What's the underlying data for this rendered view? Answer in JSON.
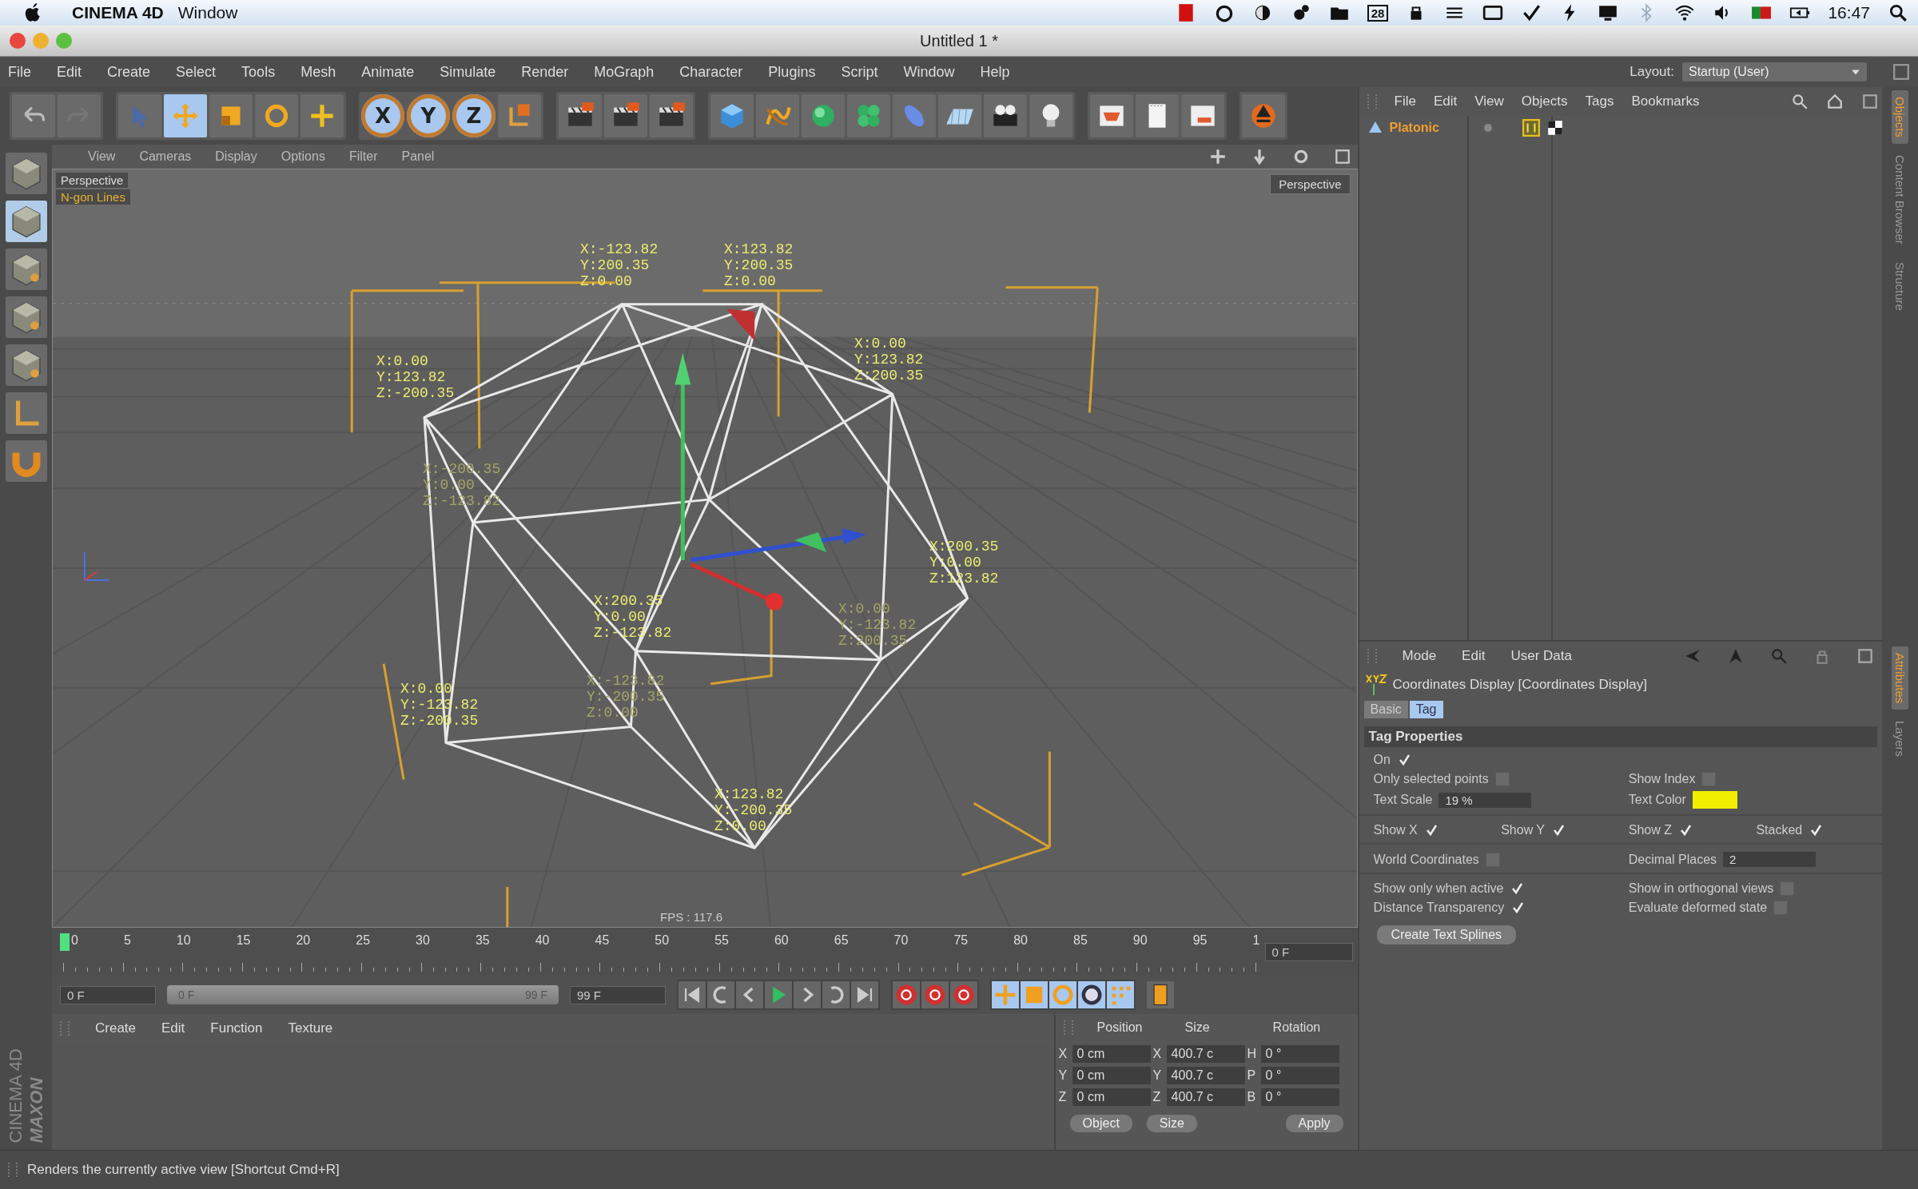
{
  "mac_menubar": {
    "app": "CINEMA 4D",
    "menus": [
      "Window"
    ],
    "calendar_day": "28",
    "time": "16:47"
  },
  "window": {
    "title": "Untitled 1 *"
  },
  "menu_bar": {
    "items": [
      "File",
      "Edit",
      "Create",
      "Select",
      "Tools",
      "Mesh",
      "Animate",
      "Simulate",
      "Render",
      "MoGraph",
      "Character",
      "Plugins",
      "Script",
      "Window",
      "Help"
    ],
    "layout_label": "Layout:",
    "layout_value": "Startup (User)"
  },
  "toolbar": {
    "tools": [
      {
        "selected": false
      },
      {
        "selected": true
      },
      {
        "selected": false
      },
      {
        "selected": false
      },
      {
        "selected": false
      }
    ],
    "axis_locks": [
      {
        "label": "X",
        "selected": true
      },
      {
        "label": "Y",
        "selected": true
      },
      {
        "label": "Z",
        "selected": true
      }
    ]
  },
  "viewport": {
    "menu": [
      "View",
      "Cameras",
      "Display",
      "Options",
      "Filter",
      "Panel"
    ],
    "camera_label": "Perspective",
    "display_label": "N-gon Lines",
    "view_button": "Perspective",
    "fps": "FPS : 117.6",
    "coordinate_labels": [
      {
        "lines": [
          "X:-123.82",
          "Y:200.35",
          "Z:0.00"
        ],
        "faded": false
      },
      {
        "lines": [
          "X:123.82",
          "Y:200.35",
          "Z:0.00"
        ],
        "faded": false
      },
      {
        "lines": [
          "X:0.00",
          "Y:123.82",
          "Z:-200.35"
        ],
        "faded": false
      },
      {
        "lines": [
          "X:0.00",
          "Y:123.82",
          "Z:200.35"
        ],
        "faded": false
      },
      {
        "lines": [
          "X:200.35",
          "Y:0.00",
          "Z:123.82"
        ],
        "faded": false
      },
      {
        "lines": [
          "X:200.35",
          "Y:0.00",
          "Z:-123.82"
        ],
        "faded": false
      },
      {
        "lines": [
          "X:0.00",
          "Y:-123.82",
          "Z:-200.35"
        ],
        "faded": false
      },
      {
        "lines": [
          "X:123.82",
          "Y:-200.35",
          "Z:0.00"
        ],
        "faded": false
      },
      {
        "lines": [
          "X:-200.35",
          "Y:0.00",
          "Z:-123.82"
        ],
        "faded": true
      },
      {
        "lines": [
          "X:0.00",
          "Y:-123.82",
          "Z:200.35"
        ],
        "faded": true
      },
      {
        "lines": [
          "X:-123.82",
          "Y:-200.35",
          "Z:0.00"
        ],
        "faded": true
      }
    ]
  },
  "timeline": {
    "ticks": [
      "0",
      "5",
      "10",
      "15",
      "20",
      "25",
      "30",
      "35",
      "40",
      "45",
      "50",
      "55",
      "60",
      "65",
      "70",
      "75",
      "80",
      "85",
      "90",
      "95",
      "1"
    ],
    "frame_field": "0 F"
  },
  "transport": {
    "start_field": "0 F",
    "range_start": "0 F",
    "range_end": "99 F",
    "end_field": "99 F",
    "range": {
      "level": 1
    }
  },
  "materials": {
    "menu": [
      "Create",
      "Edit",
      "Function",
      "Texture"
    ]
  },
  "coordinates": {
    "headers": [
      "Position",
      "Size",
      "Rotation"
    ],
    "rows": [
      {
        "pos_axis": "X",
        "pos": "0 cm",
        "size_axis": "X",
        "size": "400.7 c",
        "rot_axis": "H",
        "rot": "0 °"
      },
      {
        "pos_axis": "Y",
        "pos": "0 cm",
        "size_axis": "Y",
        "size": "400.7 c",
        "rot_axis": "P",
        "rot": "0 °"
      },
      {
        "pos_axis": "Z",
        "pos": "0 cm",
        "size_axis": "Z",
        "size": "400.7 c",
        "rot_axis": "B",
        "rot": "0 °"
      }
    ],
    "mode_dropdown": "Object",
    "size_dropdown": "Size",
    "apply": "Apply"
  },
  "object_manager": {
    "menu": [
      "File",
      "Edit",
      "View",
      "Objects",
      "Tags",
      "Bookmarks"
    ],
    "objects": [
      {
        "name": "Platonic",
        "selected": true
      }
    ]
  },
  "attributes": {
    "menu": [
      "Mode",
      "Edit",
      "User Data"
    ],
    "title": "Coordinates Display [Coordinates Display]",
    "tabs": [
      {
        "label": "Basic",
        "selected": false
      },
      {
        "label": "Tag",
        "selected": true
      }
    ],
    "section": "Tag Properties",
    "rows": [
      [
        {
          "kind": "checkbox",
          "label": "On",
          "checked": true
        }
      ],
      [
        {
          "kind": "checkbox",
          "label": "Only selected points",
          "checked": false
        },
        {
          "kind": "checkbox",
          "label": "Show Index",
          "checked": false
        }
      ],
      [
        {
          "kind": "number",
          "label": "Text Scale",
          "value": "19 %"
        },
        {
          "kind": "color",
          "label": "Text Color",
          "color": "#f2ee00"
        }
      ],
      [
        {
          "kind": "checkbox",
          "label": "Show X",
          "checked": true
        },
        {
          "kind": "checkbox",
          "label": "Show Y",
          "checked": true
        },
        {
          "kind": "checkbox",
          "label": "Show Z",
          "checked": true
        },
        {
          "kind": "checkbox",
          "label": "Stacked",
          "checked": true
        }
      ],
      [
        {
          "kind": "checkbox",
          "label": "World Coordinates",
          "checked": false
        },
        {
          "kind": "number",
          "label": "Decimal Places",
          "value": "2"
        }
      ],
      [
        {
          "kind": "checkbox",
          "label": "Show only when active",
          "checked": true
        },
        {
          "kind": "checkbox",
          "label": "Show in orthogonal views",
          "checked": false
        }
      ],
      [
        {
          "kind": "checkbox",
          "label": "Distance Transparency",
          "checked": true
        },
        {
          "kind": "checkbox",
          "label": "Evaluate deformed state",
          "checked": false
        }
      ]
    ],
    "button": "Create Text Splines"
  },
  "side_tabs_top": [
    {
      "label": "Objects",
      "selected": true
    },
    {
      "label": "Content Browser",
      "selected": false
    },
    {
      "label": "Structure",
      "selected": false
    }
  ],
  "side_tabs_bottom": [
    {
      "label": "Attributes",
      "selected": true
    },
    {
      "label": "Layers",
      "selected": false
    }
  ],
  "brand": [
    "MAXON",
    "CINEMA 4D"
  ],
  "status_bar": "Renders the currently active view [Shortcut Cmd+R]"
}
